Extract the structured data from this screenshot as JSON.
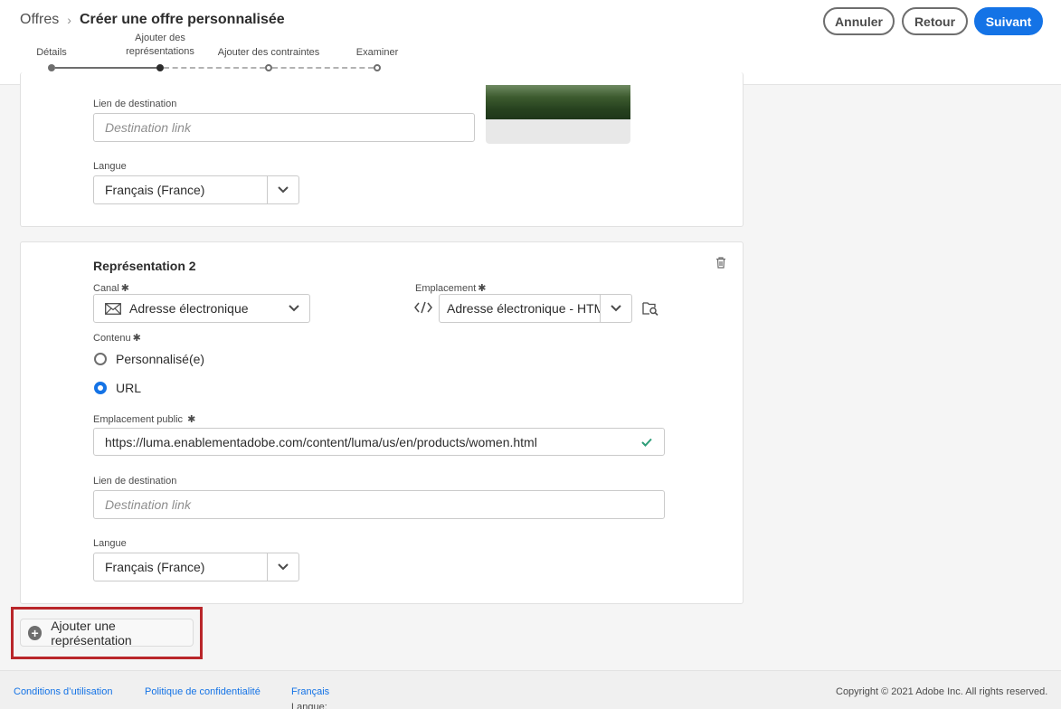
{
  "breadcrumb": {
    "parent": "Offres",
    "separator": "›",
    "title": "Créer une offre personnalisée"
  },
  "actions": {
    "cancel": "Annuler",
    "back": "Retour",
    "next": "Suivant"
  },
  "steps": [
    {
      "label": "Détails",
      "state": "done"
    },
    {
      "label": "Ajouter des représentations",
      "line1": "Ajouter des",
      "line2": "représentations",
      "state": "current"
    },
    {
      "label": "Ajouter des contraintes",
      "state": "todo"
    },
    {
      "label": "Examiner",
      "state": "todo"
    }
  ],
  "rep1": {
    "destination_label": "Lien de destination",
    "destination_placeholder": "Destination link",
    "language_label": "Langue",
    "language_value": "Français (France)"
  },
  "rep2": {
    "title": "Représentation 2",
    "channel_label": "Canal",
    "channel_value": "Adresse électronique",
    "placement_label": "Emplacement",
    "placement_value": "Adresse électronique - HTML",
    "content_label": "Contenu",
    "content_options": [
      {
        "label": "Personnalisé(e)",
        "selected": false
      },
      {
        "label": "URL",
        "selected": true
      }
    ],
    "public_location_label": "Emplacement public",
    "public_location_value": "https://luma.enablementadobe.com/content/luma/us/en/products/women.html",
    "destination_label": "Lien de destination",
    "destination_placeholder": "Destination link",
    "language_label": "Langue",
    "language_value": "Français (France)",
    "required_mark": "✱"
  },
  "add_representation": "Ajouter une représentation",
  "footer": {
    "terms": "Conditions d’utilisation",
    "privacy": "Politique de confidentialité",
    "language_label": "Langue:",
    "language_value": "Français",
    "copyright": "Copyright © 2021 Adobe Inc. All rights reserved."
  },
  "colors": {
    "accent": "#1473e6",
    "highlight": "#b9262a",
    "success": "#2d9d78"
  }
}
